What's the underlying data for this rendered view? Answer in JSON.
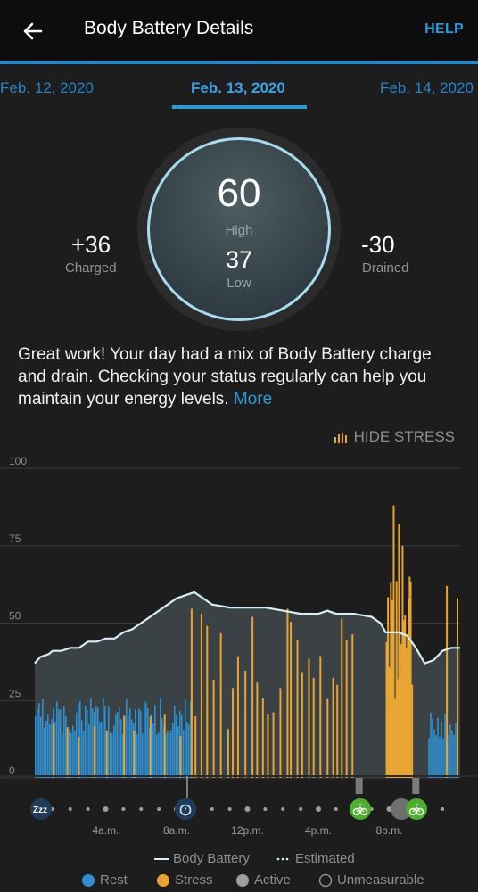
{
  "header": {
    "title": "Body Battery Details",
    "help_label": "HELP"
  },
  "date_tabs": [
    {
      "label": "Feb. 12, 2020",
      "active": false
    },
    {
      "label": "Feb. 13, 2020",
      "active": true
    },
    {
      "label": "Feb. 14, 2020",
      "active": false
    }
  ],
  "gauge": {
    "high_value": "60",
    "high_label": "High",
    "low_value": "37",
    "low_label": "Low",
    "ring_color": "#a7dbef"
  },
  "charged": {
    "value": "+36",
    "label": "Charged"
  },
  "drained": {
    "value": "-30",
    "label": "Drained"
  },
  "summary": {
    "text": "Great work! Your day had a mix of Body Battery charge and drain. Checking your status regularly can help you maintain your energy levels.",
    "more_label": "More"
  },
  "stress_toggle": {
    "label": "HIDE STRESS",
    "icon": "bar-chart-icon"
  },
  "chart_data": {
    "type": "area",
    "y_ticks": [
      "100",
      "75",
      "50",
      "25",
      "0"
    ],
    "ylim": [
      0,
      100
    ],
    "x_labels": [
      "4a.m.",
      "8a.m.",
      "12p.m.",
      "4p.m.",
      "8p.m."
    ],
    "body_battery": {
      "name": "Body Battery",
      "hours": [
        0,
        0.3,
        0.8,
        1,
        1.5,
        2,
        2.5,
        3,
        3.5,
        4,
        4.5,
        5,
        5.5,
        6,
        6.5,
        7,
        7.5,
        8,
        8.5,
        9,
        10,
        11,
        12,
        13,
        14,
        15,
        16,
        16.5,
        17,
        18,
        19,
        19.5,
        19.8,
        20.5,
        21,
        21.5,
        22,
        22.5,
        23,
        23.5,
        24
      ],
      "values": [
        37,
        39,
        40,
        41,
        41,
        42,
        42,
        44,
        44,
        45,
        45,
        47,
        48,
        50,
        52,
        54,
        56,
        58,
        59,
        60,
        56,
        55,
        55,
        55,
        54,
        53,
        53,
        54,
        53,
        53,
        52,
        50,
        47,
        47,
        46,
        42,
        37,
        38,
        41,
        42,
        42
      ]
    },
    "rest_period_hours": [
      0,
      8.8
    ],
    "stress_peak_hours": [
      20.1,
      20.7
    ],
    "event_icons": [
      {
        "name": "sleep-icon",
        "hour": 0.2
      },
      {
        "name": "alarm-clock-icon",
        "hour": 8.5
      },
      {
        "name": "cycling-icon",
        "hour": 18.3
      },
      {
        "name": "cycling-icon",
        "hour": 21.5
      }
    ],
    "colors": {
      "rest": "#2f8fcf",
      "stress": "#e8a533",
      "active": "#9e9e9e",
      "line": "#d6eef6",
      "area": "#3c4549"
    }
  },
  "legend": {
    "body_battery": "Body Battery",
    "estimated": "Estimated",
    "rest": "Rest",
    "stress": "Stress",
    "active": "Active",
    "unmeasurable": "Unmeasurable"
  }
}
